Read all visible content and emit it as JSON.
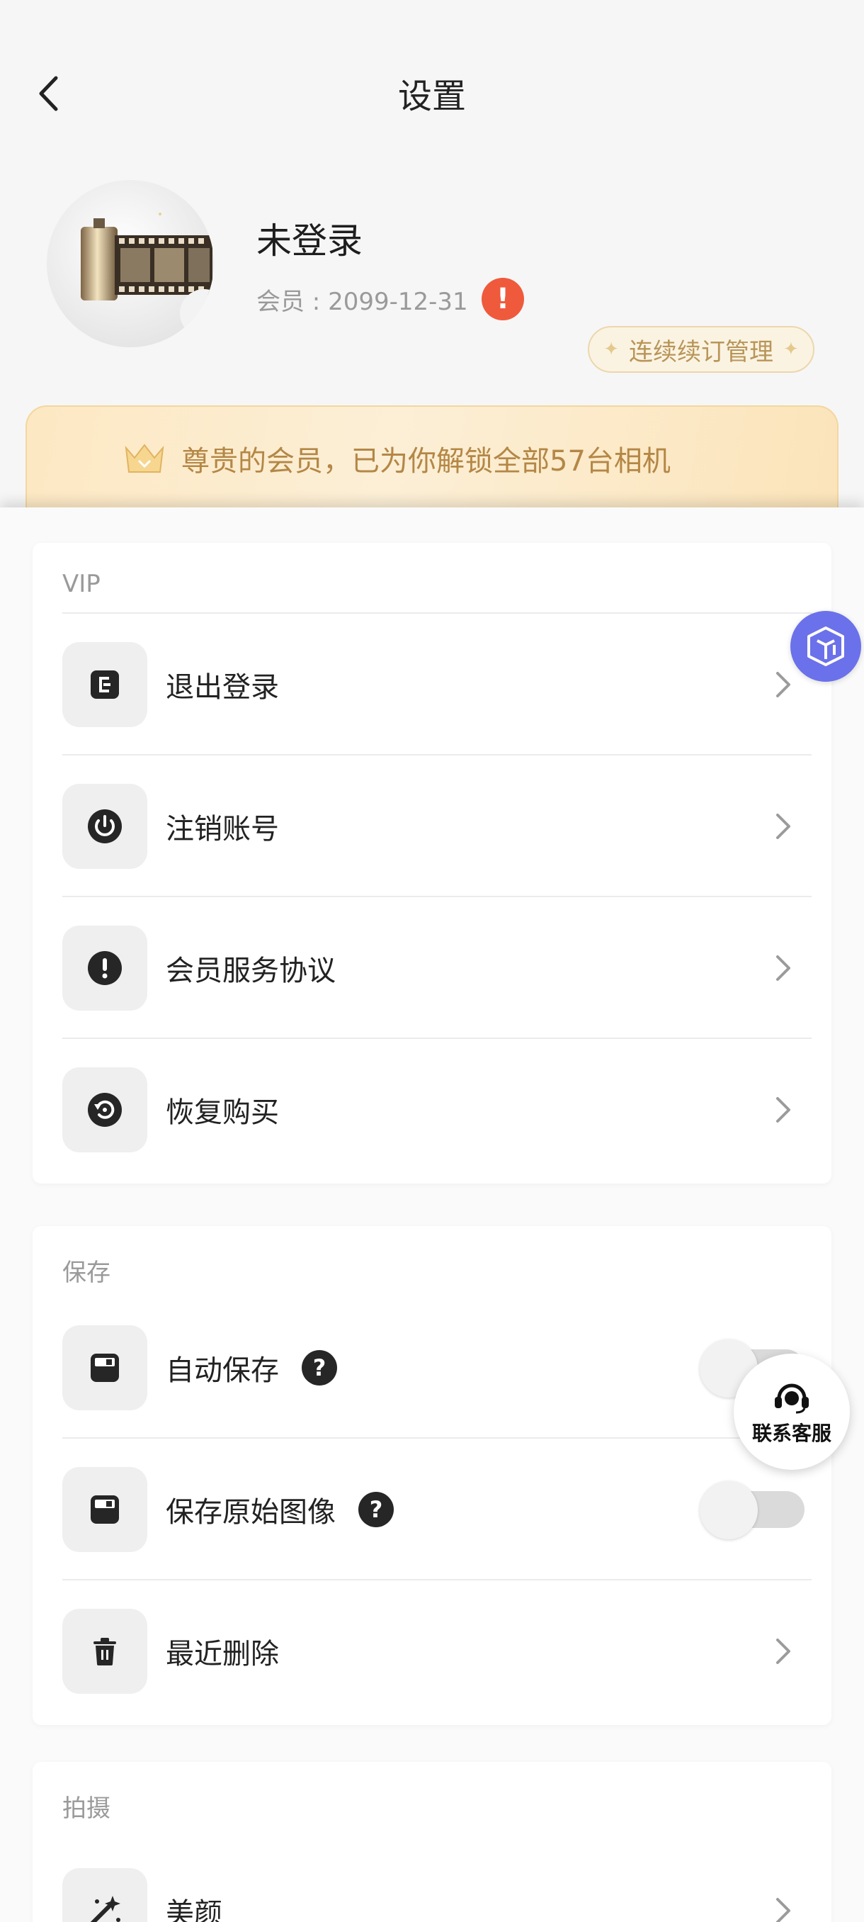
{
  "header": {
    "title": "设置"
  },
  "profile": {
    "name": "未登录",
    "member_label": "会员 : 2099-12-31",
    "alert_glyph": "!",
    "renew_button": "连续续订管理"
  },
  "vip_banner": {
    "text": "尊贵的会员，已为你解锁全部57台相机"
  },
  "sections": {
    "vip": {
      "title": "VIP",
      "items": [
        {
          "label": "退出登录",
          "icon": "logout-icon"
        },
        {
          "label": "注销账号",
          "icon": "power-icon"
        },
        {
          "label": "会员服务协议",
          "icon": "exclamation-icon"
        },
        {
          "label": "恢复购买",
          "icon": "restore-icon"
        }
      ]
    },
    "save": {
      "title": "保存",
      "items": [
        {
          "label": "自动保存",
          "icon": "save-icon",
          "help": "?",
          "toggle": false
        },
        {
          "label": "保存原始图像",
          "icon": "save-icon",
          "help": "?",
          "toggle": false
        },
        {
          "label": "最近删除",
          "icon": "trash-icon"
        }
      ]
    },
    "shoot": {
      "title": "拍摄",
      "items": [
        {
          "label": "美颜",
          "icon": "magic-wand-icon"
        }
      ]
    }
  },
  "floating": {
    "customer_service": "联系客服"
  },
  "colors": {
    "accent_gold": "#b48746",
    "alert_red": "#ef5a3c",
    "cube_blue": "#6b71ea"
  }
}
